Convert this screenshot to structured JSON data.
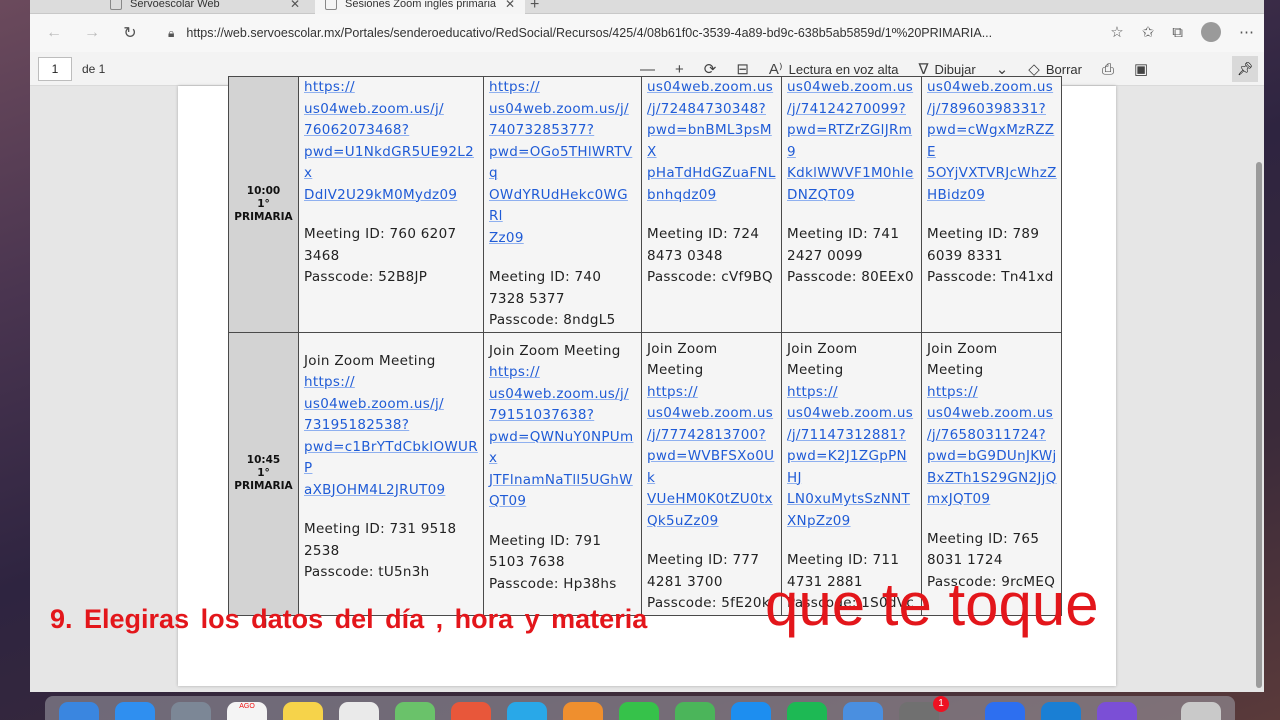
{
  "browser": {
    "tabs": [
      {
        "label": "Servoescolar Web"
      },
      {
        "label": "Sesiones Zoom ingles primaria"
      }
    ],
    "url": "https://web.servoescolar.mx/Portales/senderoeducativo/RedSocial/Recursos/425/4/08b61f0c-3539-4a89-bd9c-638b5ab5859d/1º%20PRIMARIA...",
    "icons": [
      "back-icon",
      "forward-icon",
      "reload-icon",
      "lock-icon",
      "star-icon",
      "favorites-icon",
      "collections-icon",
      "profile-avatar",
      "more-icon"
    ]
  },
  "pdf_toolbar": {
    "page_current": "1",
    "page_of": "de 1",
    "read_aloud_label": "Lectura en voz alta",
    "draw_label": "Dibujar",
    "erase_label": "Borrar"
  },
  "schedule": {
    "rows": [
      {
        "time": "10:00",
        "grade": "1°",
        "level": "PRIMARIA",
        "cells": [
          {
            "join": "",
            "link_lines": [
              "https://",
              "us04web.zoom.us/j/",
              "76062073468?",
              "pwd=U1NkdGR5UE92L2x",
              "DdlV2U29kM0Mydz09"
            ],
            "meeting_id": "Meeting ID: 760 6207 3468",
            "passcode": "Passcode: 52B8JP"
          },
          {
            "join": "",
            "link_lines": [
              "https://",
              "us04web.zoom.us/j/",
              "74073285377?",
              "pwd=OGo5THlWRTVq",
              "OWdYRUdHekc0WGRl",
              "Zz09"
            ],
            "meeting_id": "Meeting ID: 740 7328 5377",
            "passcode": "Passcode: 8ndgL5"
          },
          {
            "join": "",
            "link_lines": [
              "us04web.zoom.us",
              "/j/72484730348?",
              "pwd=bnBML3psMX",
              "pHaTdHdGZuaFNL",
              "bnhqdz09"
            ],
            "meeting_id": "Meeting ID: 724 8473 0348",
            "passcode": "Passcode: cVf9BQ"
          },
          {
            "join": "",
            "link_lines": [
              "us04web.zoom.us",
              "/j/74124270099?",
              "pwd=RTZrZGlJRm9",
              "KdklWWVF1M0hIe",
              "DNZQT09"
            ],
            "meeting_id": "Meeting ID: 741 2427 0099",
            "passcode": "Passcode: 80EEx0"
          },
          {
            "join": "",
            "link_lines": [
              "us04web.zoom.us",
              "/j/78960398331?",
              "pwd=cWgxMzRZZE",
              "5OYjVXTVRJcWhzZ",
              "HBidz09"
            ],
            "meeting_id": "Meeting ID: 789 6039 8331",
            "passcode": "Passcode: Tn41xd"
          }
        ]
      },
      {
        "time": "10:45",
        "grade": "1°",
        "level": "PRIMARIA",
        "cells": [
          {
            "join": "Join Zoom Meeting",
            "link_lines": [
              "https://",
              "us04web.zoom.us/j/",
              "73195182538?",
              "pwd=c1BrYTdCbklOWURP",
              "aXBJOHM4L2JRUT09"
            ],
            "meeting_id": "Meeting ID: 731 9518 2538",
            "passcode": "Passcode: tU5n3h"
          },
          {
            "join": "Join Zoom Meeting",
            "link_lines": [
              "https://",
              "us04web.zoom.us/j/",
              "79151037638?",
              "pwd=QWNuY0NPUmx",
              "JTFlnamNaTll5UGhW",
              "QT09"
            ],
            "meeting_id": "Meeting ID: 791 5103 7638",
            "passcode": "Passcode: Hp38hs"
          },
          {
            "join": "Join Zoom Meeting",
            "link_lines": [
              "https://",
              "us04web.zoom.us",
              "/j/77742813700?",
              "pwd=WVBFSXo0Uk",
              "VUeHM0K0tZU0tx",
              "Qk5uZz09"
            ],
            "meeting_id": "Meeting ID: 777 4281 3700",
            "passcode": "Passcode: 5fE20k"
          },
          {
            "join": "Join Zoom Meeting",
            "link_lines": [
              "https://",
              "us04web.zoom.us",
              "/j/71147312881?",
              "pwd=K2J1ZGpPNHJ",
              "LN0xuMytsSzNNT",
              "XNpZz09"
            ],
            "meeting_id": "Meeting ID: 711 4731 2881",
            "passcode": "Passcode: 1S0dVc"
          },
          {
            "join": "Join Zoom Meeting",
            "link_lines": [
              "https://",
              "us04web.zoom.us",
              "/j/76580311724?",
              "pwd=bG9DUnJKWj",
              "BxZTh1S29GN2JjQ",
              "mxJQT09"
            ],
            "meeting_id": "Meeting ID: 765 8031 1724",
            "passcode": "Passcode: 9rcMEQ"
          }
        ]
      }
    ]
  },
  "caption": {
    "left": "9. Elegiras  los datos del día , hora y materia",
    "right": "que te toque",
    "color": "#e3161b"
  },
  "dock": {
    "calendar_month": "AGO",
    "badge_count": "1"
  }
}
